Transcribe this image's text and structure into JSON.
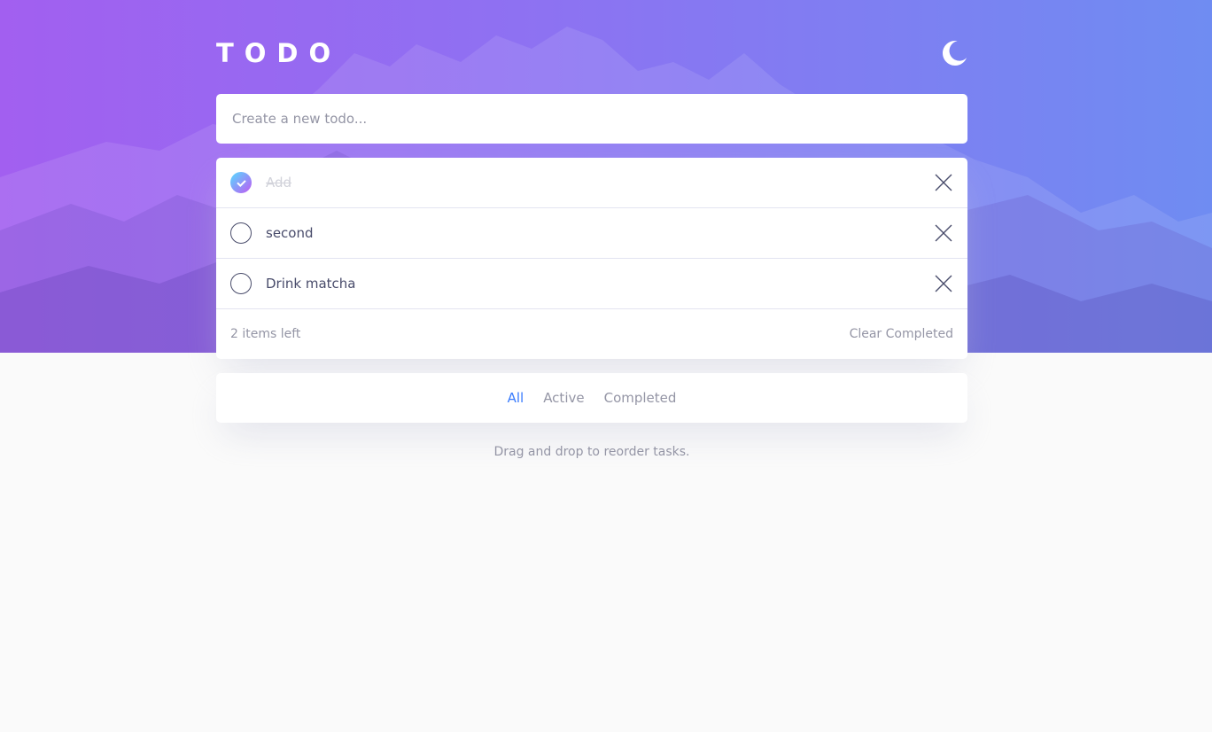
{
  "app": {
    "title": "TODO",
    "theme_icon": "moon-icon"
  },
  "new_todo": {
    "placeholder": "Create a new todo..."
  },
  "todos": [
    {
      "text": "Add",
      "completed": true
    },
    {
      "text": "second",
      "completed": false
    },
    {
      "text": "Drink matcha",
      "completed": false
    }
  ],
  "footer": {
    "items_left": "2 items left",
    "clear_label": "Clear Completed"
  },
  "filters": {
    "all": "All",
    "active": "Active",
    "completed": "Completed",
    "selected": "All"
  },
  "hint": "Drag and drop to reorder tasks.",
  "colors": {
    "accent": "#3a7cfd",
    "check_gradient_start": "#55ddff",
    "check_gradient_end": "#c058f3",
    "hero_gradient_start": "#a25ff0",
    "hero_gradient_end": "#6f8cf2",
    "text": "#494c6b",
    "muted": "#9495a5"
  }
}
